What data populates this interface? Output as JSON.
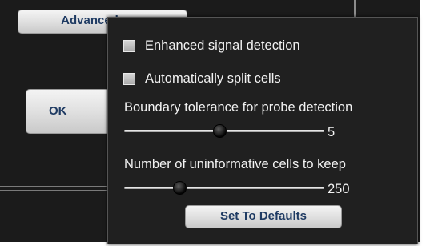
{
  "background_dialog": {
    "advanced_label": "Advanced",
    "ok_label": "OK"
  },
  "popup": {
    "enhanced_signal_detection": {
      "label": "Enhanced signal detection",
      "checked": false
    },
    "auto_split_cells": {
      "label": "Automatically split cells",
      "checked": false
    },
    "boundary_tolerance": {
      "label": "Boundary tolerance for probe detection",
      "value": "5",
      "slider_fraction": 0.48
    },
    "uninformative_cells": {
      "label": "Number of uninformative cells to keep",
      "value": "250",
      "slider_fraction": 0.28
    },
    "set_defaults_label": "Set To Defaults"
  },
  "colors": {
    "panel_background": "#202020",
    "button_text": "#1f3b63",
    "text": "#f2f2f2"
  }
}
